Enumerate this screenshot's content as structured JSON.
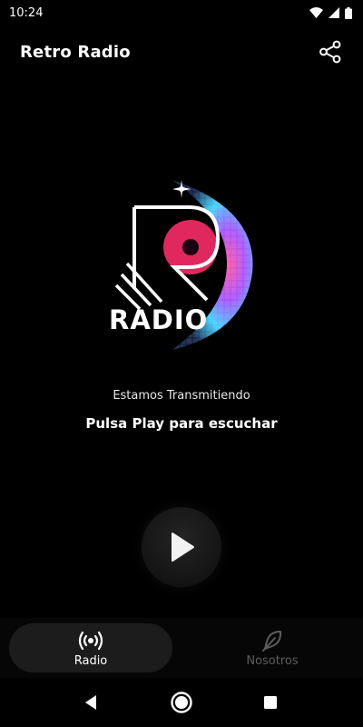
{
  "status_bar": {
    "time": "10:24"
  },
  "app_bar": {
    "title": "Retro Radio",
    "share_icon": "share-icon"
  },
  "logo": {
    "text": "RADIO",
    "letter": "R"
  },
  "player": {
    "status_text": "Estamos Transmitiendo",
    "prompt_text": "Pulsa Play para escuchar",
    "play_icon": "play-icon"
  },
  "bottom_nav": {
    "items": [
      {
        "label": "Radio",
        "icon": "radio-broadcast-icon",
        "active": true
      },
      {
        "label": "Nosotros",
        "icon": "feather-icon",
        "active": false
      }
    ]
  },
  "colors": {
    "background": "#000000",
    "accent_pink": "#e0285f",
    "accent_cyan": "#3ad0ff",
    "inactive": "#5d5d5d"
  }
}
